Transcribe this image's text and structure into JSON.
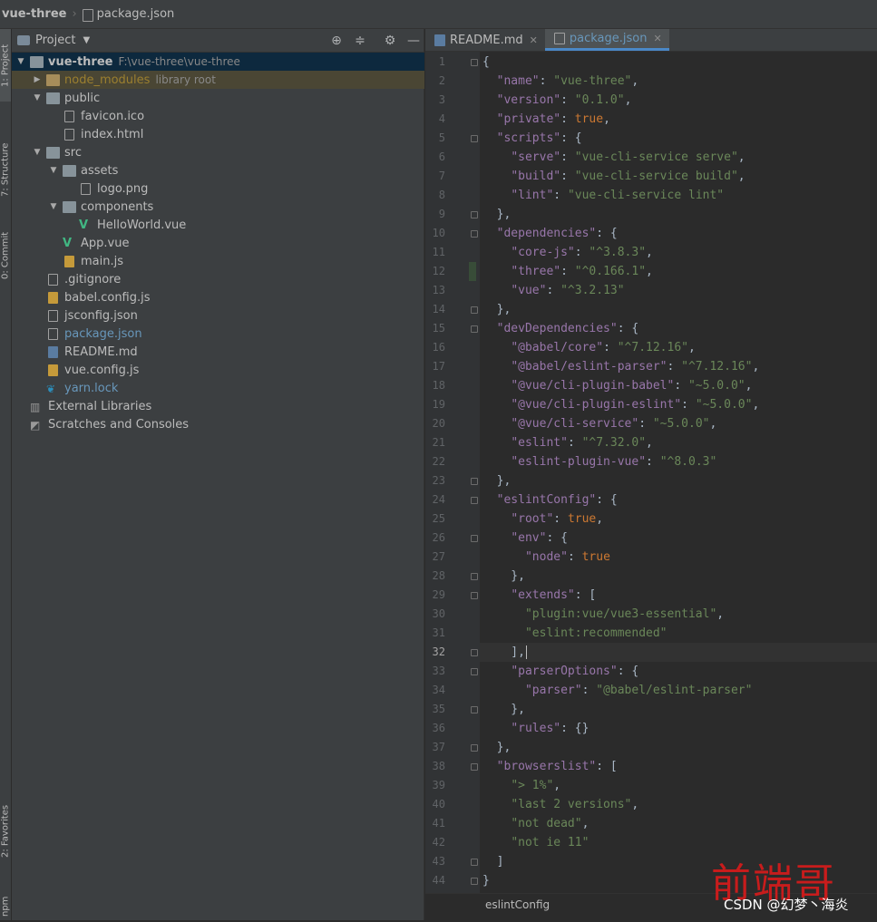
{
  "breadcrumb": {
    "project": "vue-three",
    "file": "package.json"
  },
  "tool_strip": {
    "project": "1: Project",
    "structure": "7: Structure",
    "commit": "0: Commit",
    "favorites": "2: Favorites",
    "npm": "npm"
  },
  "project_panel": {
    "title": "Project",
    "tree": [
      {
        "label": "vue-three",
        "extra": "F:\\vue-three\\vue-three",
        "depth": 0,
        "arrow": "down",
        "icon": "folder-icon",
        "style": "bold",
        "selected": true
      },
      {
        "label": "node_modules",
        "extra": "library root",
        "depth": 1,
        "arrow": "right",
        "icon": "folder-orange-icon",
        "style": "olive",
        "library": true
      },
      {
        "label": "public",
        "depth": 1,
        "arrow": "down",
        "icon": "folder-icon"
      },
      {
        "label": "favicon.ico",
        "depth": 2,
        "icon": "file-icon"
      },
      {
        "label": "index.html",
        "depth": 2,
        "icon": "html-file-icon"
      },
      {
        "label": "src",
        "depth": 1,
        "arrow": "down",
        "icon": "folder-icon"
      },
      {
        "label": "assets",
        "depth": 2,
        "arrow": "down",
        "icon": "folder-icon"
      },
      {
        "label": "logo.png",
        "depth": 3,
        "icon": "image-file-icon"
      },
      {
        "label": "components",
        "depth": 2,
        "arrow": "down",
        "icon": "folder-icon"
      },
      {
        "label": "HelloWorld.vue",
        "depth": 3,
        "icon": "vue-file-icon"
      },
      {
        "label": "App.vue",
        "depth": 2,
        "icon": "vue-file-icon"
      },
      {
        "label": "main.js",
        "depth": 2,
        "icon": "js-file-icon"
      },
      {
        "label": ".gitignore",
        "depth": 1,
        "icon": "file-icon"
      },
      {
        "label": "babel.config.js",
        "depth": 1,
        "icon": "js-file-icon"
      },
      {
        "label": "jsconfig.json",
        "depth": 1,
        "icon": "json-file-icon"
      },
      {
        "label": "package.json",
        "depth": 1,
        "icon": "json-file-icon",
        "style": "blue"
      },
      {
        "label": "README.md",
        "depth": 1,
        "icon": "md-file-icon"
      },
      {
        "label": "vue.config.js",
        "depth": 1,
        "icon": "js-file-icon"
      },
      {
        "label": "yarn.lock",
        "depth": 1,
        "icon": "yarn-file-icon",
        "style": "blue"
      },
      {
        "label": "External Libraries",
        "depth": 0,
        "icon": "library-icon"
      },
      {
        "label": "Scratches and Consoles",
        "depth": 0,
        "icon": "scratches-icon"
      }
    ]
  },
  "editor_tabs": [
    {
      "label": "README.md",
      "icon": "md-file-icon",
      "active": false
    },
    {
      "label": "package.json",
      "icon": "json-file-icon",
      "active": true
    }
  ],
  "current_line": 32,
  "changed_line": 12,
  "code_lines": [
    [
      [
        "p",
        "{"
      ]
    ],
    [
      [
        "p",
        "  "
      ],
      [
        "k",
        "\"name\""
      ],
      [
        "p",
        ": "
      ],
      [
        "s",
        "\"vue-three\""
      ],
      [
        "p",
        ","
      ]
    ],
    [
      [
        "p",
        "  "
      ],
      [
        "k",
        "\"version\""
      ],
      [
        "p",
        ": "
      ],
      [
        "s",
        "\"0.1.0\""
      ],
      [
        "p",
        ","
      ]
    ],
    [
      [
        "p",
        "  "
      ],
      [
        "k",
        "\"private\""
      ],
      [
        "p",
        ": "
      ],
      [
        "b",
        "true"
      ],
      [
        "p",
        ","
      ]
    ],
    [
      [
        "p",
        "  "
      ],
      [
        "k",
        "\"scripts\""
      ],
      [
        "p",
        ": {"
      ]
    ],
    [
      [
        "p",
        "    "
      ],
      [
        "k",
        "\"serve\""
      ],
      [
        "p",
        ": "
      ],
      [
        "s",
        "\"vue-cli-service serve\""
      ],
      [
        "p",
        ","
      ]
    ],
    [
      [
        "p",
        "    "
      ],
      [
        "k",
        "\"build\""
      ],
      [
        "p",
        ": "
      ],
      [
        "s",
        "\"vue-cli-service build\""
      ],
      [
        "p",
        ","
      ]
    ],
    [
      [
        "p",
        "    "
      ],
      [
        "k",
        "\"lint\""
      ],
      [
        "p",
        ": "
      ],
      [
        "s",
        "\"vue-cli-service lint\""
      ]
    ],
    [
      [
        "p",
        "  },"
      ]
    ],
    [
      [
        "p",
        "  "
      ],
      [
        "k",
        "\"dependencies\""
      ],
      [
        "p",
        ": {"
      ]
    ],
    [
      [
        "p",
        "    "
      ],
      [
        "k",
        "\"core-js\""
      ],
      [
        "p",
        ": "
      ],
      [
        "s",
        "\"^3.8.3\""
      ],
      [
        "p",
        ","
      ]
    ],
    [
      [
        "p",
        "    "
      ],
      [
        "k",
        "\"three\""
      ],
      [
        "p",
        ": "
      ],
      [
        "s",
        "\"^0.166.1\""
      ],
      [
        "p",
        ","
      ]
    ],
    [
      [
        "p",
        "    "
      ],
      [
        "k",
        "\"vue\""
      ],
      [
        "p",
        ": "
      ],
      [
        "s",
        "\"^3.2.13\""
      ]
    ],
    [
      [
        "p",
        "  },"
      ]
    ],
    [
      [
        "p",
        "  "
      ],
      [
        "k",
        "\"devDependencies\""
      ],
      [
        "p",
        ": {"
      ]
    ],
    [
      [
        "p",
        "    "
      ],
      [
        "k",
        "\"@babel/core\""
      ],
      [
        "p",
        ": "
      ],
      [
        "s",
        "\"^7.12.16\""
      ],
      [
        "p",
        ","
      ]
    ],
    [
      [
        "p",
        "    "
      ],
      [
        "k",
        "\"@babel/eslint-parser\""
      ],
      [
        "p",
        ": "
      ],
      [
        "s",
        "\"^7.12.16\""
      ],
      [
        "p",
        ","
      ]
    ],
    [
      [
        "p",
        "    "
      ],
      [
        "k",
        "\"@vue/cli-plugin-babel\""
      ],
      [
        "p",
        ": "
      ],
      [
        "s",
        "\"~5.0.0\""
      ],
      [
        "p",
        ","
      ]
    ],
    [
      [
        "p",
        "    "
      ],
      [
        "k",
        "\"@vue/cli-plugin-eslint\""
      ],
      [
        "p",
        ": "
      ],
      [
        "s",
        "\"~5.0.0\""
      ],
      [
        "p",
        ","
      ]
    ],
    [
      [
        "p",
        "    "
      ],
      [
        "k",
        "\"@vue/cli-service\""
      ],
      [
        "p",
        ": "
      ],
      [
        "s",
        "\"~5.0.0\""
      ],
      [
        "p",
        ","
      ]
    ],
    [
      [
        "p",
        "    "
      ],
      [
        "k",
        "\"eslint\""
      ],
      [
        "p",
        ": "
      ],
      [
        "s",
        "\"^7.32.0\""
      ],
      [
        "p",
        ","
      ]
    ],
    [
      [
        "p",
        "    "
      ],
      [
        "k",
        "\"eslint-plugin-vue\""
      ],
      [
        "p",
        ": "
      ],
      [
        "s",
        "\"^8.0.3\""
      ]
    ],
    [
      [
        "p",
        "  },"
      ]
    ],
    [
      [
        "p",
        "  "
      ],
      [
        "k",
        "\"eslintConfig\""
      ],
      [
        "p",
        ": {"
      ]
    ],
    [
      [
        "p",
        "    "
      ],
      [
        "k",
        "\"root\""
      ],
      [
        "p",
        ": "
      ],
      [
        "b",
        "true"
      ],
      [
        "p",
        ","
      ]
    ],
    [
      [
        "p",
        "    "
      ],
      [
        "k",
        "\"env\""
      ],
      [
        "p",
        ": {"
      ]
    ],
    [
      [
        "p",
        "      "
      ],
      [
        "k",
        "\"node\""
      ],
      [
        "p",
        ": "
      ],
      [
        "b",
        "true"
      ]
    ],
    [
      [
        "p",
        "    },"
      ]
    ],
    [
      [
        "p",
        "    "
      ],
      [
        "k",
        "\"extends\""
      ],
      [
        "p",
        ": ["
      ]
    ],
    [
      [
        "p",
        "      "
      ],
      [
        "s",
        "\"plugin:vue/vue3-essential\""
      ],
      [
        "p",
        ","
      ]
    ],
    [
      [
        "p",
        "      "
      ],
      [
        "s",
        "\"eslint:recommended\""
      ]
    ],
    [
      [
        "p",
        "    ],"
      ]
    ],
    [
      [
        "p",
        "    "
      ],
      [
        "k",
        "\"parserOptions\""
      ],
      [
        "p",
        ": {"
      ]
    ],
    [
      [
        "p",
        "      "
      ],
      [
        "k",
        "\"parser\""
      ],
      [
        "p",
        ": "
      ],
      [
        "s",
        "\"@babel/eslint-parser\""
      ]
    ],
    [
      [
        "p",
        "    },"
      ]
    ],
    [
      [
        "p",
        "    "
      ],
      [
        "k",
        "\"rules\""
      ],
      [
        "p",
        ": {}"
      ]
    ],
    [
      [
        "p",
        "  },"
      ]
    ],
    [
      [
        "p",
        "  "
      ],
      [
        "k",
        "\"browserslist\""
      ],
      [
        "p",
        ": ["
      ]
    ],
    [
      [
        "p",
        "    "
      ],
      [
        "s",
        "\"> 1%\""
      ],
      [
        "p",
        ","
      ]
    ],
    [
      [
        "p",
        "    "
      ],
      [
        "s",
        "\"last 2 versions\""
      ],
      [
        "p",
        ","
      ]
    ],
    [
      [
        "p",
        "    "
      ],
      [
        "s",
        "\"not dead\""
      ],
      [
        "p",
        ","
      ]
    ],
    [
      [
        "p",
        "    "
      ],
      [
        "s",
        "\"not ie 11\""
      ]
    ],
    [
      [
        "p",
        "  ]"
      ]
    ],
    [
      [
        "p",
        "}"
      ]
    ]
  ],
  "fold_lines": [
    1,
    5,
    9,
    10,
    14,
    15,
    23,
    24,
    26,
    28,
    29,
    32,
    33,
    35,
    37,
    38,
    43,
    44
  ],
  "status_breadcrumb": "eslintConfig",
  "watermark": {
    "cn": "前端哥",
    "csdn": "CSDN @幻梦丶海炎"
  },
  "colors": {
    "key": "#9876aa",
    "string": "#6a8759",
    "keyword": "#cc7832",
    "accent": "#4a88c7"
  }
}
